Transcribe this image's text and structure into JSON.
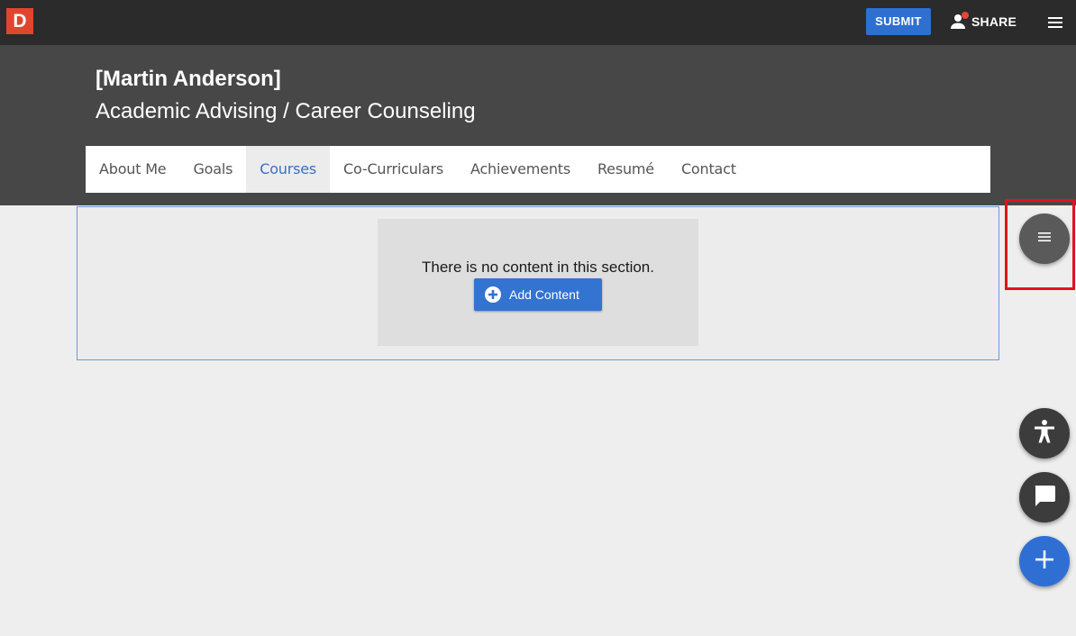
{
  "topbar": {
    "logo_letter": "D",
    "submit_label": "SUBMIT",
    "share_label": "SHARE"
  },
  "profile": {
    "name": "[Martin Anderson]",
    "program": "Academic Advising / Career Counseling"
  },
  "tabs": [
    {
      "label": "About Me",
      "active": false
    },
    {
      "label": "Goals",
      "active": false
    },
    {
      "label": "Courses",
      "active": true
    },
    {
      "label": "Co-Curriculars",
      "active": false
    },
    {
      "label": "Achievements",
      "active": false
    },
    {
      "label": "Resumé",
      "active": false
    },
    {
      "label": "Contact",
      "active": false
    }
  ],
  "section": {
    "empty_message": "There is no content in this section.",
    "add_content_label": "Add Content"
  },
  "colors": {
    "brand": "#e0452e",
    "accent": "#2e6fd0",
    "highlight": "#e0141e"
  },
  "icons": [
    "person-icon",
    "notification-dot",
    "hamburger-menu-icon",
    "plus-circle-icon",
    "section-menu-icon",
    "accessibility-icon",
    "chat-icon",
    "plus-icon"
  ]
}
